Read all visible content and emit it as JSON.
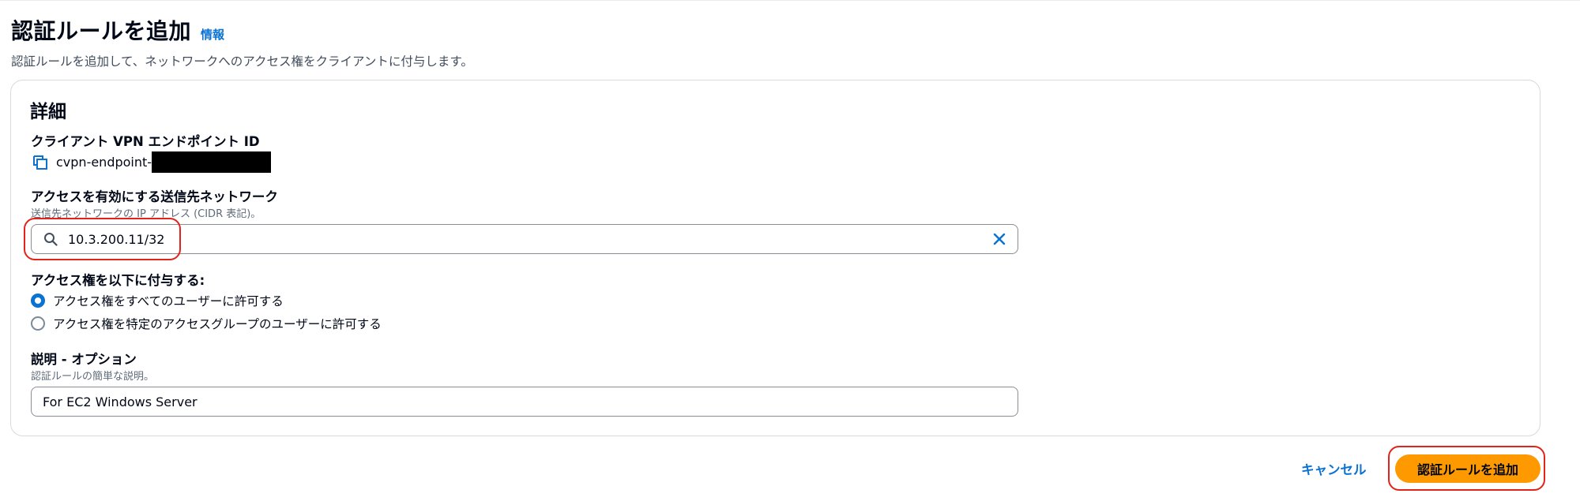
{
  "header": {
    "title": "認証ルールを追加",
    "info_link": "情報",
    "description": "認証ルールを追加して、ネットワークへのアクセス権をクライアントに付与します。"
  },
  "details": {
    "section_title": "詳細",
    "endpoint": {
      "label": "クライアント VPN エンドポイント ID",
      "value_prefix": "cvpn-endpoint-",
      "icon": "copy-icon"
    },
    "destination": {
      "label": "アクセスを有効にする送信先ネットワーク",
      "sublabel": "送信先ネットワークの IP アドレス (CIDR 表記)。",
      "value": "10.3.200.11/32",
      "icon": "search-icon",
      "clear_icon": "close-icon"
    },
    "grant": {
      "label": "アクセス権を以下に付与する:",
      "options": [
        {
          "label": "アクセス権をすべてのユーザーに許可する",
          "selected": true
        },
        {
          "label": "アクセス権を特定のアクセスグループのユーザーに許可する",
          "selected": false
        }
      ]
    },
    "description_field": {
      "label": "説明 - オプション",
      "sublabel": "認証ルールの簡単な説明。",
      "value": "For EC2 Windows Server"
    }
  },
  "actions": {
    "cancel_label": "キャンセル",
    "submit_label": "認証ルールを追加"
  },
  "colors": {
    "accent": "#0972d3",
    "primary_button": "#ff9900",
    "highlight": "#e3231a"
  }
}
